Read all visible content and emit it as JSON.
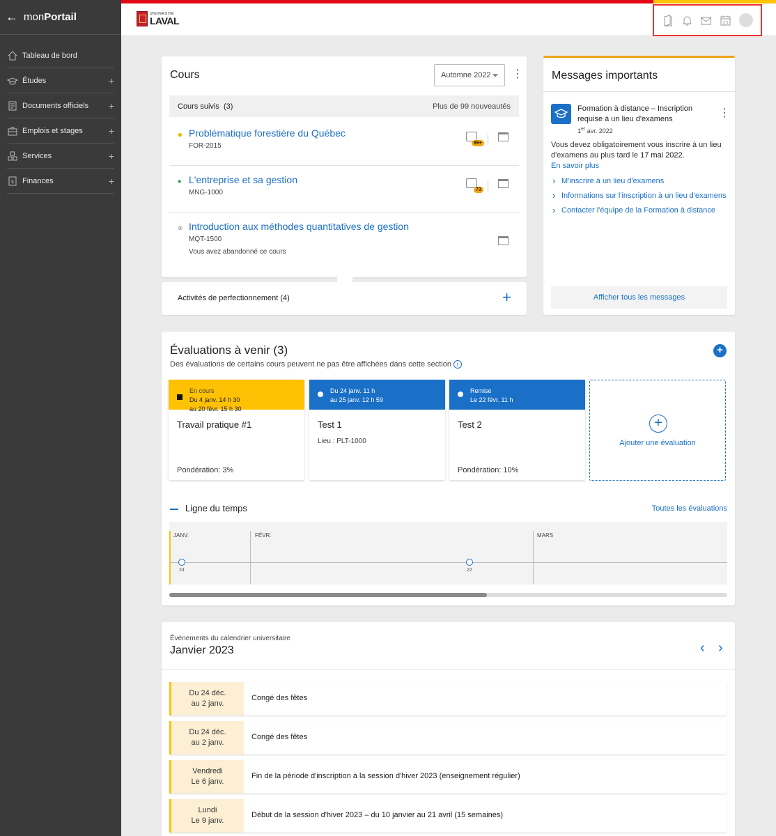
{
  "sidebar": {
    "back_label": "←",
    "brand_prefix": "mon",
    "brand_bold": "Portail",
    "items": [
      {
        "label": "Tableau de bord",
        "icon": "home-icon"
      },
      {
        "label": "Études",
        "icon": "graduation-cap-icon",
        "expand": "+"
      },
      {
        "label": "Documents officiels",
        "icon": "document-icon",
        "expand": "+"
      },
      {
        "label": "Emplois et stages",
        "icon": "briefcase-icon",
        "expand": "+"
      },
      {
        "label": "Services",
        "icon": "services-icon",
        "expand": "+"
      },
      {
        "label": "Finances",
        "icon": "finance-icon",
        "expand": "+"
      }
    ]
  },
  "header": {
    "logo_small": "UNIVERSITÉ",
    "logo_big": "LAVAL",
    "icons": [
      "book-icon",
      "bell-icon",
      "mail-icon",
      "calendar-icon",
      "avatar"
    ],
    "calendar_day": "23",
    "colors": {
      "red": "#e30513",
      "yellow": "#ffc103"
    }
  },
  "cours": {
    "title": "Cours",
    "session": "Automne 2022",
    "followed_label": "Cours suivis",
    "followed_count": "(3)",
    "news": "Plus de 99 nouveautés",
    "courses": [
      {
        "name": "Problématique forestière du Québec",
        "code": "FOR-2015",
        "marker": "◆",
        "badge": "99+"
      },
      {
        "name": "L'entreprise et sa gestion",
        "code": "MNG-1000",
        "marker": "●",
        "badge": "73"
      },
      {
        "name": "Introduction aux méthodes quantitatives de gestion",
        "code": "MQT-1500",
        "marker": "⊗",
        "note": "Vous avez abandonné ce cours"
      }
    ],
    "activities_label": "Activités de perfectionnement (4)",
    "activities_plus": "+"
  },
  "messages": {
    "title": "Messages importants",
    "item_title": "Formation à distance – Inscription requise à un lieu d'examens",
    "date_day": "1",
    "date_sup": "er",
    "date_rest": " avr. 2022",
    "body_1": "Vous devez obligatoirement vous inscrire à un lieu d'examens au plus tard le ",
    "body_bold": "17 mai 2022",
    "body_2": ".",
    "more": "En savoir plus",
    "links": [
      "M'inscrire à un lieu d'examens",
      "Informations sur l'inscription à un lieu d'examens",
      "Contacter l'équipe de la Formation à distance"
    ],
    "all": "Afficher tous les messages"
  },
  "evaluations": {
    "title": "Évaluations à venir (3)",
    "subtitle": "Des évaluations de certains cours peuvent ne pas être affichées dans cette section",
    "add_icon": "+",
    "cards": [
      {
        "status": "En cours",
        "line1": "Du 4 janv. 14 h 30",
        "line2": "au 20 févr. 15 h 30",
        "name": "Travail pratique #1",
        "meta": "Pondération: 3%",
        "color": "#ffc103"
      },
      {
        "status": "",
        "line1": "Du 24 janv. 11 h",
        "line2": "au 25 janv. 12 h 59",
        "name": "Test 1",
        "lieu": "Lieu : PLT-1000",
        "color": "#1a6fc7"
      },
      {
        "status": "Remise",
        "line1": "Le 22 févr. 11 h",
        "line2": "",
        "name": "Test 2",
        "meta": "Pondération: 10%",
        "color": "#1a6fc7"
      }
    ],
    "new_label": "Ajouter une évaluation",
    "timeline_title": "Ligne du temps",
    "timeline_all": "Toutes les évaluations",
    "months": [
      "JANV.",
      "FÉVR.",
      "MARS"
    ],
    "points": [
      "24",
      "22"
    ]
  },
  "calendar": {
    "subtitle": "Événements du calendrier universitaire",
    "title": "Janvier 2023",
    "prev": "‹",
    "next": "›",
    "events": [
      {
        "date1": "Du 24 déc.",
        "date2": "au 2 janv.",
        "text": "Congé des fêtes"
      },
      {
        "date1": "Du 24 déc.",
        "date2": "au 2 janv.",
        "text": "Congé des fêtes"
      },
      {
        "date1": "Vendredi",
        "date2": "Le 6 janv.",
        "text": "Fin de la période d'inscription à la session d'hiver 2023 (enseignement régulier)"
      },
      {
        "date1": "Lundi",
        "date2": "Le 9 janv.",
        "text": "Début de la session d'hiver 2023 – du 10 janvier au 21 avril (15 semaines)"
      }
    ]
  }
}
